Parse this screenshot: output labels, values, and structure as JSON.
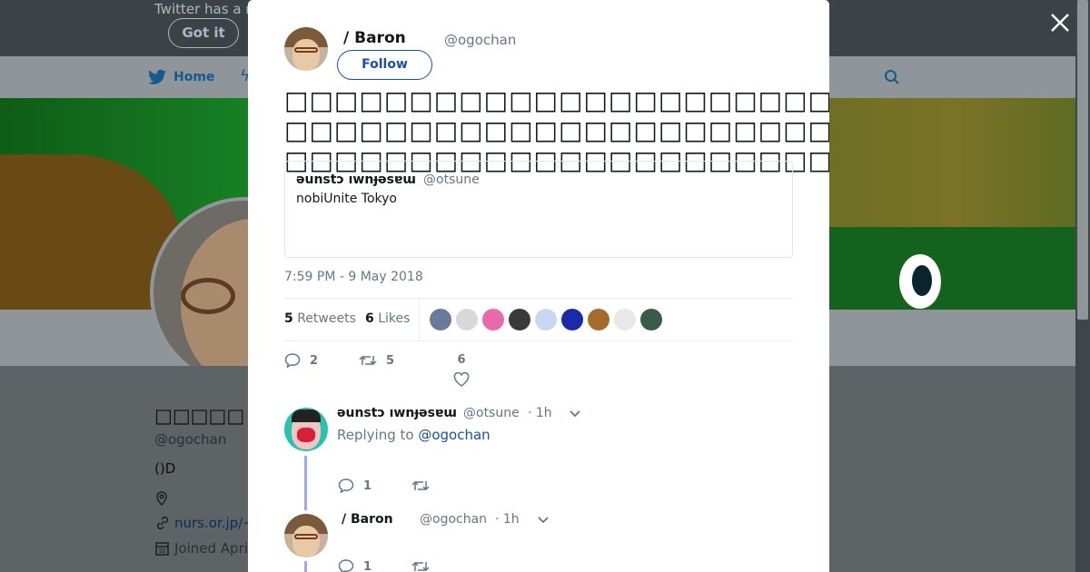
{
  "background": {
    "notice_text": "Twitter has a n",
    "got_it_label": "Got it",
    "nav": {
      "home_label": "Home"
    },
    "profile": {
      "name": "□□□□□ / Ba",
      "handle": "@ogochan",
      "bio": "()D",
      "link": "nurs.or.jp/~",
      "joined": "Joined April"
    }
  },
  "modal": {
    "author": {
      "name": "/ Baron",
      "handle": "@ogochan"
    },
    "follow_label": "Follow",
    "tweet_text": "□□□□□□□□□□□□□□□□□□□□□□□□□□□□□□□□□□□□□□□□□□□□□□□□□□□□□□□□□□□□□□□□□□□□□□□□□□□□□□□□□□□□□□□□",
    "quote": {
      "name": "əunstɔ ıwnɟəsɐɯ",
      "handle": "@otsune",
      "text": "nobiUnite Tokyo"
    },
    "timestamp": "7:59 PM - 9 May 2018",
    "stats": {
      "retweets_count": "5",
      "retweets_label": "Retweets",
      "likes_count": "6",
      "likes_label": "Likes"
    },
    "liker_colors": [
      "#6a7a9a",
      "#d8d8d8",
      "#e86aa8",
      "#3a3a3a",
      "#c8d8f0",
      "#1a2aa8",
      "#a86a2a",
      "#e8e8e8",
      "#3a5a4a"
    ],
    "actions": {
      "reply_count": "2",
      "retweet_count": "5",
      "like_count": "6"
    },
    "replies": [
      {
        "name": "əunstɔ ıwnɟəsɐɯ",
        "handle": "@otsune",
        "time": "· 1h",
        "replying_prefix": "Replying to",
        "replying_to": "@ogochan",
        "reply_count": "1"
      },
      {
        "name": "/ Baron",
        "handle": "@ogochan",
        "time": "· 1h",
        "reply_count": "1"
      }
    ]
  },
  "colors": {
    "accent": "#1b4da5",
    "twitter_blue": "#1da1f2",
    "thread_line": "#a0a8f4"
  }
}
